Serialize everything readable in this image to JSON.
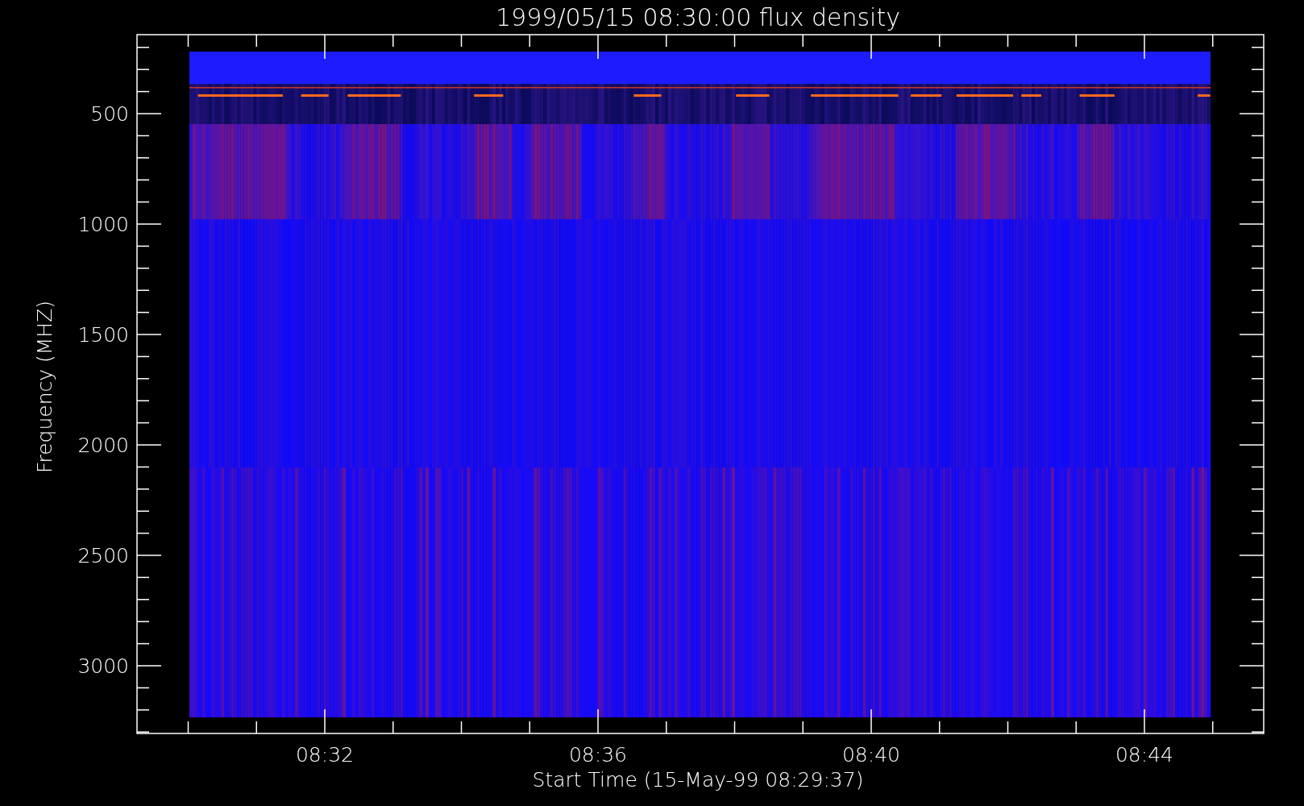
{
  "title": "1999/05/15 08:30:00 flux density",
  "y_axis": {
    "label": "Frequency (MHZ)",
    "ticks": [
      "500",
      "1000",
      "1500",
      "2000",
      "2500",
      "3000"
    ]
  },
  "x_axis": {
    "label": "Start Time (15-May-99 08:29:37)",
    "ticks": [
      "08:32",
      "08:36",
      "08:40",
      "08:44"
    ]
  }
}
